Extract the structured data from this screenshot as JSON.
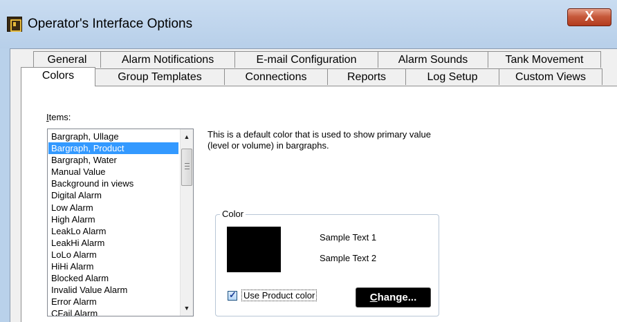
{
  "window": {
    "title": "Operator's Interface Options",
    "close_symbol": "X"
  },
  "tabs": {
    "row1": [
      "General",
      "Alarm Notifications",
      "E-mail Configuration",
      "Alarm Sounds",
      "Tank Movement"
    ],
    "row2": [
      "Colors",
      "Group Templates",
      "Connections",
      "Reports",
      "Log Setup",
      "Custom Views"
    ],
    "active": "Colors"
  },
  "items": {
    "label_mnemonic": "I",
    "label_rest": "tems:",
    "list": [
      "Bargraph, Ullage",
      "Bargraph, Product",
      "Bargraph, Water",
      "Manual Value",
      "Background in views",
      "Digital Alarm",
      "Low Alarm",
      "High Alarm",
      "LeakLo Alarm",
      "LeakHi Alarm",
      "LoLo Alarm",
      "HiHi Alarm",
      "Blocked Alarm",
      "Invalid Value Alarm",
      "Error Alarm",
      "CFail Alarm"
    ],
    "selected": "Bargraph, Product"
  },
  "description": "This is a default color that is used to show primary value (level or volume) in bargraphs.",
  "color_group": {
    "legend": "Color",
    "swatch_color": "#000000",
    "sample_text_1": "Sample Text 1",
    "sample_text_2": "Sample Text 2",
    "checkbox_label": "Use Product color",
    "checkbox_checked": true,
    "change_mnemonic": "C",
    "change_rest": "hange..."
  },
  "icons": {
    "app": "app-icon",
    "scroll_up": "scroll-up-arrow-icon",
    "scroll_down": "scroll-down-arrow-icon"
  },
  "colors": {
    "selection": "#3399ff",
    "close_button": "#c75a3c",
    "title_bar": "#b9d1ea"
  }
}
